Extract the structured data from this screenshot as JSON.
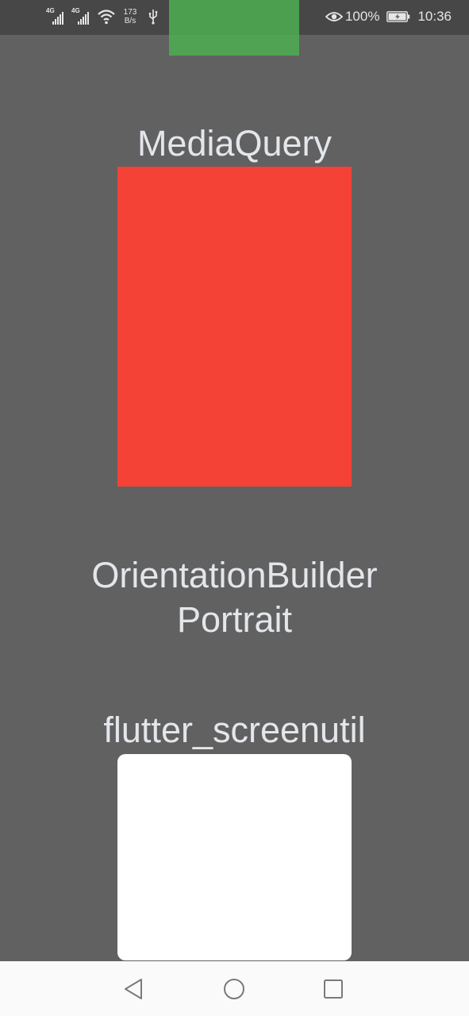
{
  "status_bar": {
    "signal1_label": "4G",
    "signal2_label": "4G",
    "net_speed_value": "173",
    "net_speed_unit": "B/s",
    "battery_percent": "100%",
    "time": "10:36"
  },
  "main": {
    "media_query_label": "MediaQuery",
    "orientation_builder_label": "OrientationBuilder",
    "orientation_value": "Portrait",
    "screenutil_label": "flutter_screenutil"
  },
  "colors": {
    "background": "#616161",
    "status_bar": "#474747",
    "green_block": "#4caf50",
    "red_box": "#f44336",
    "white_box": "#ffffff",
    "nav_bar": "#fafafa"
  },
  "icons": {
    "status": [
      "signal-icon",
      "signal-icon",
      "wifi-icon",
      "usb-icon",
      "eye-icon",
      "battery-icon"
    ],
    "nav": [
      "back-icon",
      "home-icon",
      "recent-apps-icon"
    ]
  }
}
